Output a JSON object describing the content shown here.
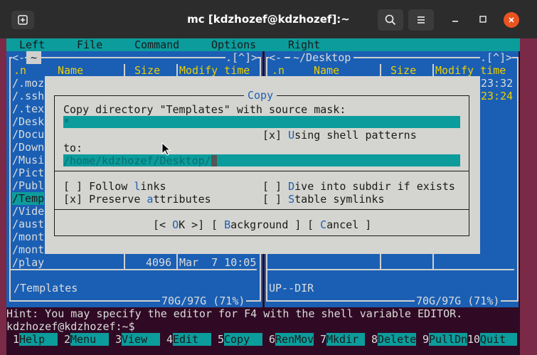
{
  "window": {
    "title": "mc [kdzhozef@kdzhozef]:~",
    "close_color": "#e95420"
  },
  "menubar": [
    "Left",
    "File",
    "Command",
    "Options",
    "Right"
  ],
  "left_panel": {
    "path_top": "~",
    "scroll_marker": ".[^]>",
    "columns": {
      "n": ".n",
      "name": "Name",
      "size": "Size",
      "mtime": "Modify time"
    },
    "rows": [
      {
        "name": "/.moz",
        "size": "",
        "mtime": "",
        "selected": false
      },
      {
        "name": "/.ssh",
        "size": "",
        "mtime": "",
        "selected": false
      },
      {
        "name": "/.tex",
        "size": "",
        "mtime": "",
        "selected": false
      },
      {
        "name": "/Desk",
        "size": "",
        "mtime": "",
        "selected": false
      },
      {
        "name": "/Docu",
        "size": "",
        "mtime": "",
        "selected": false
      },
      {
        "name": "/Down",
        "size": "",
        "mtime": "",
        "selected": false
      },
      {
        "name": "/Musi",
        "size": "",
        "mtime": "",
        "selected": false
      },
      {
        "name": "/Pict",
        "size": "",
        "mtime": "",
        "selected": false
      },
      {
        "name": "/Publ",
        "size": "",
        "mtime": "",
        "selected": false
      },
      {
        "name": "/Temp",
        "size": "",
        "mtime": "",
        "selected": true
      },
      {
        "name": "/Vide",
        "size": "",
        "mtime": "",
        "selected": false
      },
      {
        "name": "/aust",
        "size": "",
        "mtime": "",
        "selected": false
      },
      {
        "name": "/mont",
        "size": "",
        "mtime": "",
        "selected": false
      },
      {
        "name": "/mont",
        "size": "",
        "mtime": "",
        "selected": false
      },
      {
        "name": "/play",
        "size": "4096",
        "mtime": "Mar  7 10:05",
        "selected": false
      }
    ],
    "footer": "/Templates",
    "disk": "70G/97G (71%)"
  },
  "right_panel": {
    "path_top": "~/Desktop",
    "scroll_marker": ".[^]>",
    "columns": {
      "n": ".n",
      "name": "Name",
      "size": "Size",
      "mtime": "Modify time"
    },
    "times": [
      "23:32",
      "23:24"
    ],
    "footer": "UP--DIR",
    "disk": "70G/97G (71%)"
  },
  "dialog": {
    "title": "Copy",
    "source_label": "Copy directory \"Templates\" with source mask:",
    "source_value": "*",
    "shell_patterns": "[x] Using shell patterns",
    "to_label": "to:",
    "to_value": "/home/kdzhozef/Desktop/",
    "follow_links": "[ ] Follow links",
    "preserve_attrs": "[x] Preserve attributes",
    "dive_into": "[ ] Dive into subdir if exists",
    "stable_symlinks": "[ ] Stable symlinks",
    "ok": "[< OK >]",
    "background": "[ Background ]",
    "cancel": "[ Cancel ]"
  },
  "hint": "Hint: You may specify the editor for F4 with the shell variable EDITOR.",
  "prompt": "kdzhozef@kdzhozef:~$",
  "fkeys": [
    {
      "num": "1",
      "label": "Help"
    },
    {
      "num": "2",
      "label": "Menu"
    },
    {
      "num": "3",
      "label": "View"
    },
    {
      "num": "4",
      "label": "Edit"
    },
    {
      "num": "5",
      "label": "Copy"
    },
    {
      "num": "6",
      "label": "RenMov"
    },
    {
      "num": "7",
      "label": "Mkdir"
    },
    {
      "num": "8",
      "label": "Delete"
    },
    {
      "num": "9",
      "label": "PullDn"
    },
    {
      "num": "10",
      "label": "Quit"
    }
  ]
}
